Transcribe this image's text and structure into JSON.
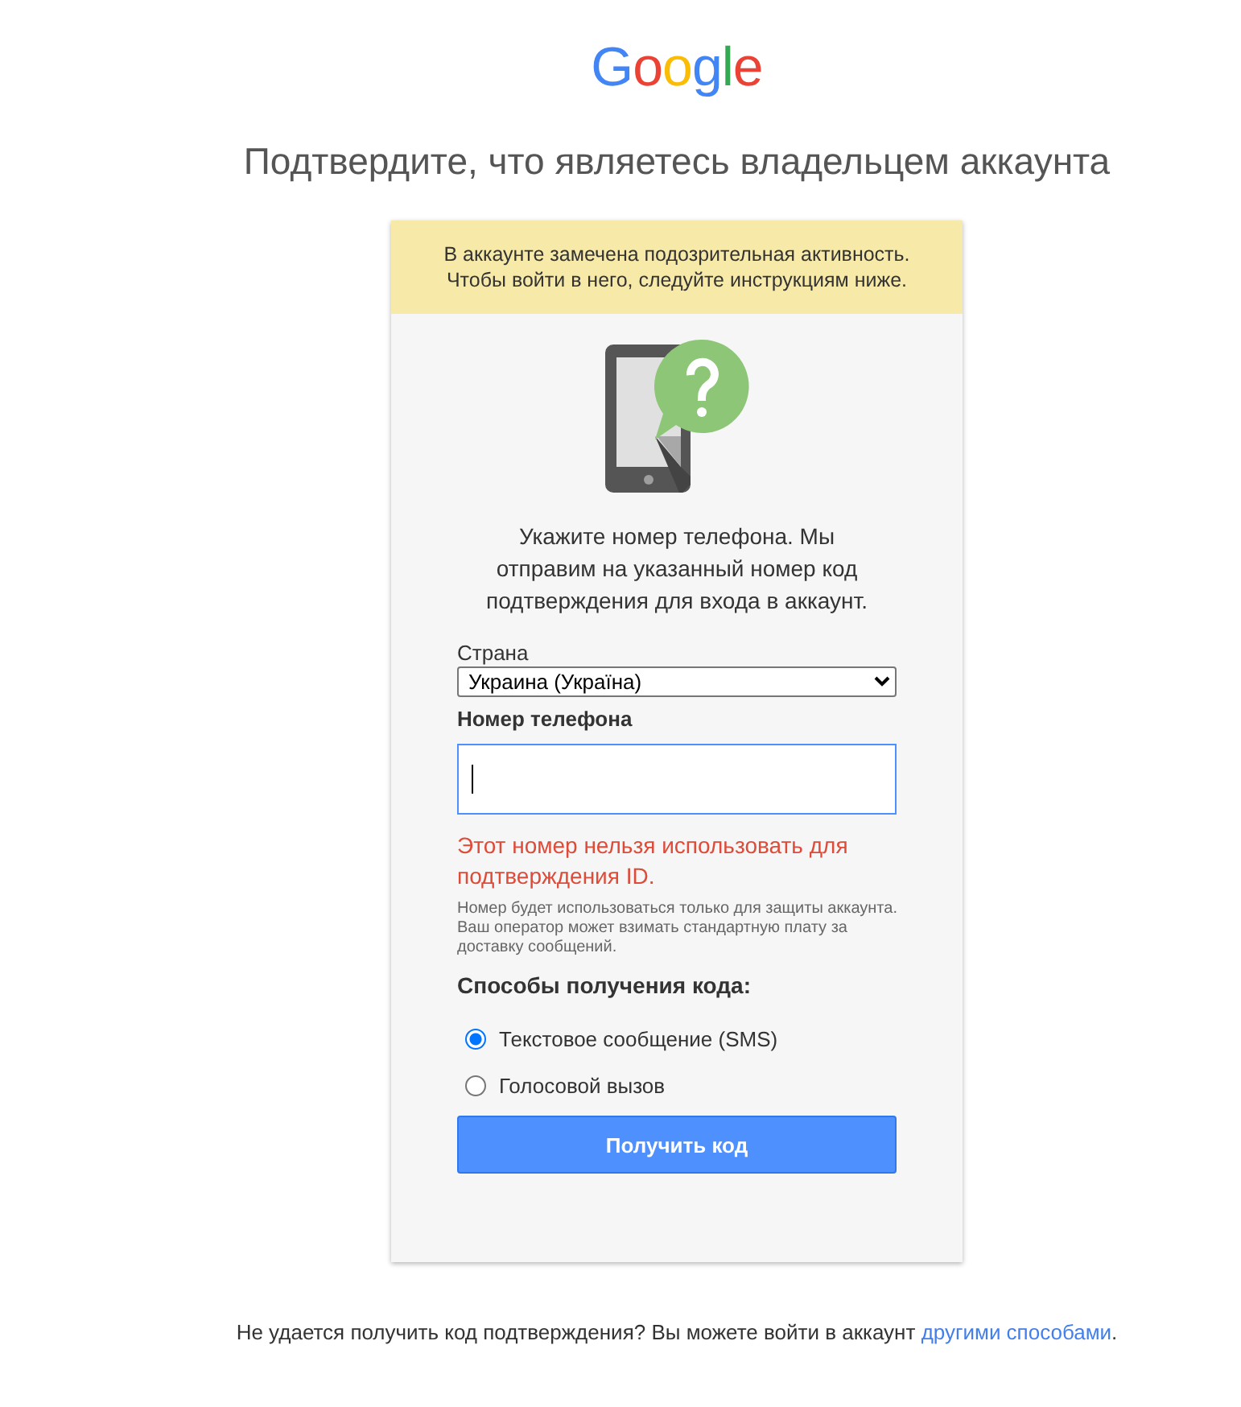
{
  "logo": {
    "letters": [
      {
        "char": "G",
        "color": "#4285f4"
      },
      {
        "char": "o",
        "color": "#ea4335"
      },
      {
        "char": "o",
        "color": "#fbbc05"
      },
      {
        "char": "g",
        "color": "#4285f4"
      },
      {
        "char": "l",
        "color": "#34a853"
      },
      {
        "char": "e",
        "color": "#ea4335"
      }
    ]
  },
  "heading": "Подтвердите, что являетесь владельцем аккаунта",
  "alert": {
    "lines": [
      "В аккаунте замечена подозрительная активность.",
      "Чтобы войти в него, следуйте инструкциям ниже."
    ]
  },
  "instructions": {
    "lines": [
      "Укажите номер телефона. Мы",
      "отправим на указанный номер код",
      "подтверждения для входа в аккаунт."
    ]
  },
  "country": {
    "label": "Страна",
    "value": "Украина (Україна)"
  },
  "phone": {
    "label": "Номер телефона",
    "focused": true
  },
  "error": "Этот номер нельзя использовать для подтверждения ID.",
  "note": "Номер будет использоваться только для защиты аккаунта. Ваш оператор может взимать стандартную плату за доставку сообщений.",
  "delivery": {
    "title": "Способы получения кода:",
    "options": [
      {
        "label": "Текстовое сообщение (SMS)",
        "selected": true
      },
      {
        "label": "Голосовой вызов",
        "selected": false
      }
    ]
  },
  "submit": "Получить код",
  "footer": {
    "text": "Не удается получить код подтверждения? Вы можете войти в аккаунт",
    "link": "другими способами",
    "end": "."
  }
}
